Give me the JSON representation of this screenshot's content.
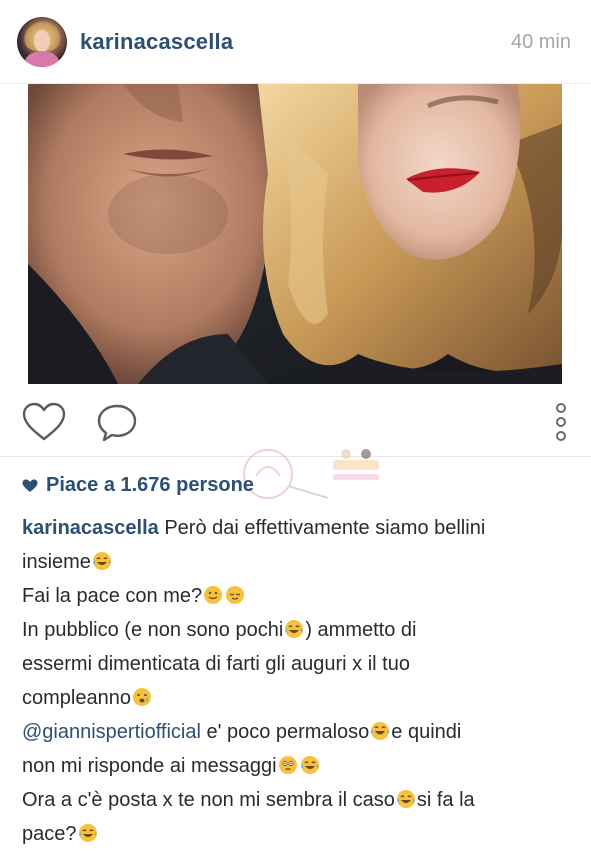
{
  "post": {
    "username": "karinacascella",
    "time": "40 min"
  },
  "likes": {
    "label": "Piace a 1.676 persone"
  },
  "caption": {
    "username": "karinacascella",
    "line1_text": "Però dai effettivamente siamo bellini",
    "line2_text": "insieme",
    "line3_text": "Fai la pace con me?",
    "line4_text": "In pubblico (e non sono pochi",
    "line4_text_b": ") ammetto di",
    "line5_text": "essermi dimenticata di farti gli auguri x il tuo",
    "line6_text": "compleanno",
    "mention": "@giannispertiofficial",
    "line7_text": " e' poco permaloso",
    "line7_text_b": "e quindi",
    "line8_text": "non mi risponde ai messaggi",
    "line9_text": "Ora a c'è posta x te non mi sembra il caso",
    "line9_text_b": "si fa la",
    "line10_text": "pace?"
  },
  "icons": {
    "like": "heart-outline-icon",
    "comment": "comment-bubble-icon",
    "more": "vertical-dots-icon",
    "likes_heart": "heart-filled-icon"
  },
  "colors": {
    "link": "#2d4f74",
    "muted": "#a6a6a6",
    "emoji": "#f6c23e"
  }
}
